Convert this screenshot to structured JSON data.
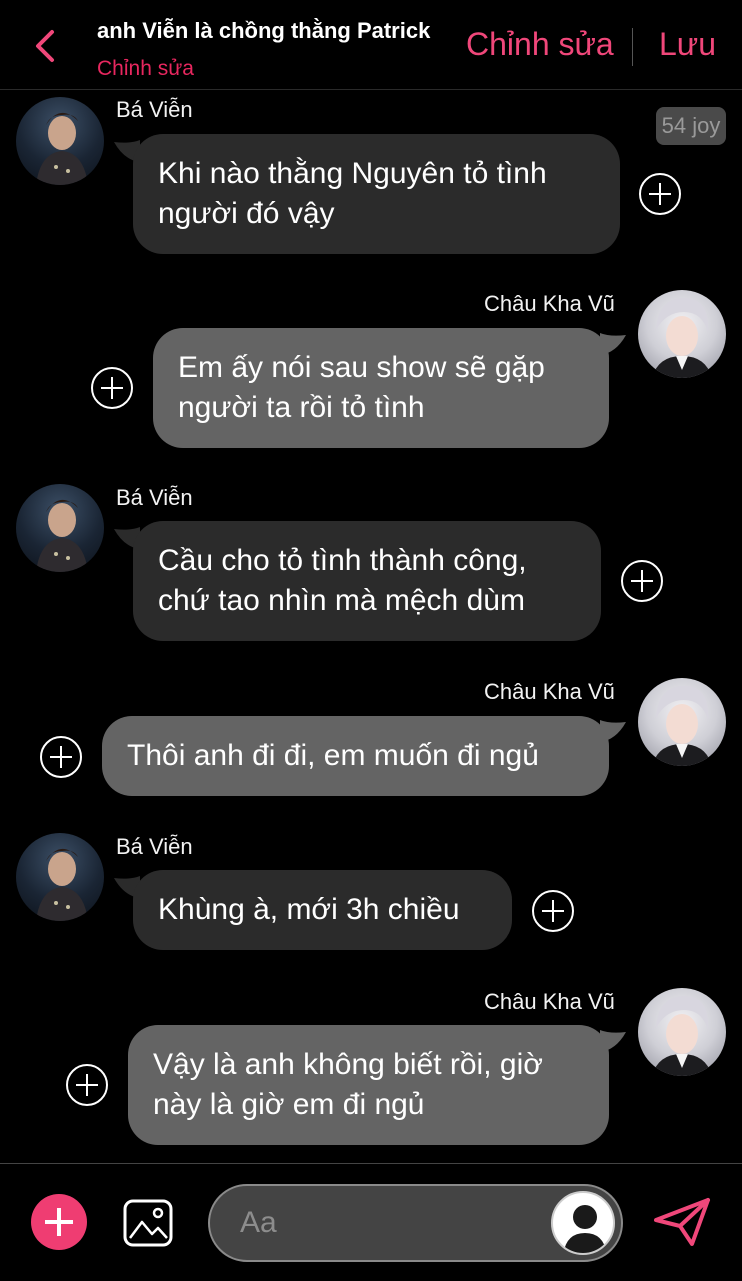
{
  "header": {
    "title": "anh Viễn là chồng thằng Patrick",
    "subtitle": "Chỉnh sửa",
    "edit_label": "Chỉnh sửa",
    "save_label": "Lưu"
  },
  "badge": {
    "joy": "54 joy"
  },
  "messages": [
    {
      "sender": "Bá Viễn",
      "side": "left",
      "lines": [
        "Khi nào thằng Nguyên tỏ tình",
        "người đó vậy"
      ]
    },
    {
      "sender": "Châu Kha Vũ",
      "side": "right",
      "lines": [
        "Em ấy nói sau show sẽ gặp",
        "người ta rồi tỏ tình"
      ]
    },
    {
      "sender": "Bá Viễn",
      "side": "left",
      "lines": [
        "Cầu cho tỏ tình thành công,",
        "chứ tao nhìn mà mệch dùm"
      ]
    },
    {
      "sender": "Châu Kha Vũ",
      "side": "right",
      "lines": [
        "Thôi anh đi đi, em muốn đi ngủ"
      ]
    },
    {
      "sender": "Bá Viễn",
      "side": "left",
      "lines": [
        "Khùng à, mới 3h chiều"
      ]
    },
    {
      "sender": "Châu Kha Vũ",
      "side": "right",
      "lines": [
        "Vậy là anh không biết rồi, giờ",
        "này là giờ em đi ngủ"
      ]
    }
  ],
  "composer": {
    "placeholder": "Aa"
  },
  "colors": {
    "accent": "#f0477a",
    "left_bubble": "#2b2b2b",
    "right_bubble": "#646464",
    "background": "#000000"
  },
  "icons": [
    "back-chevron-icon",
    "add-reaction-icon",
    "plus-icon",
    "image-icon",
    "user-avatar-icon",
    "send-icon"
  ]
}
